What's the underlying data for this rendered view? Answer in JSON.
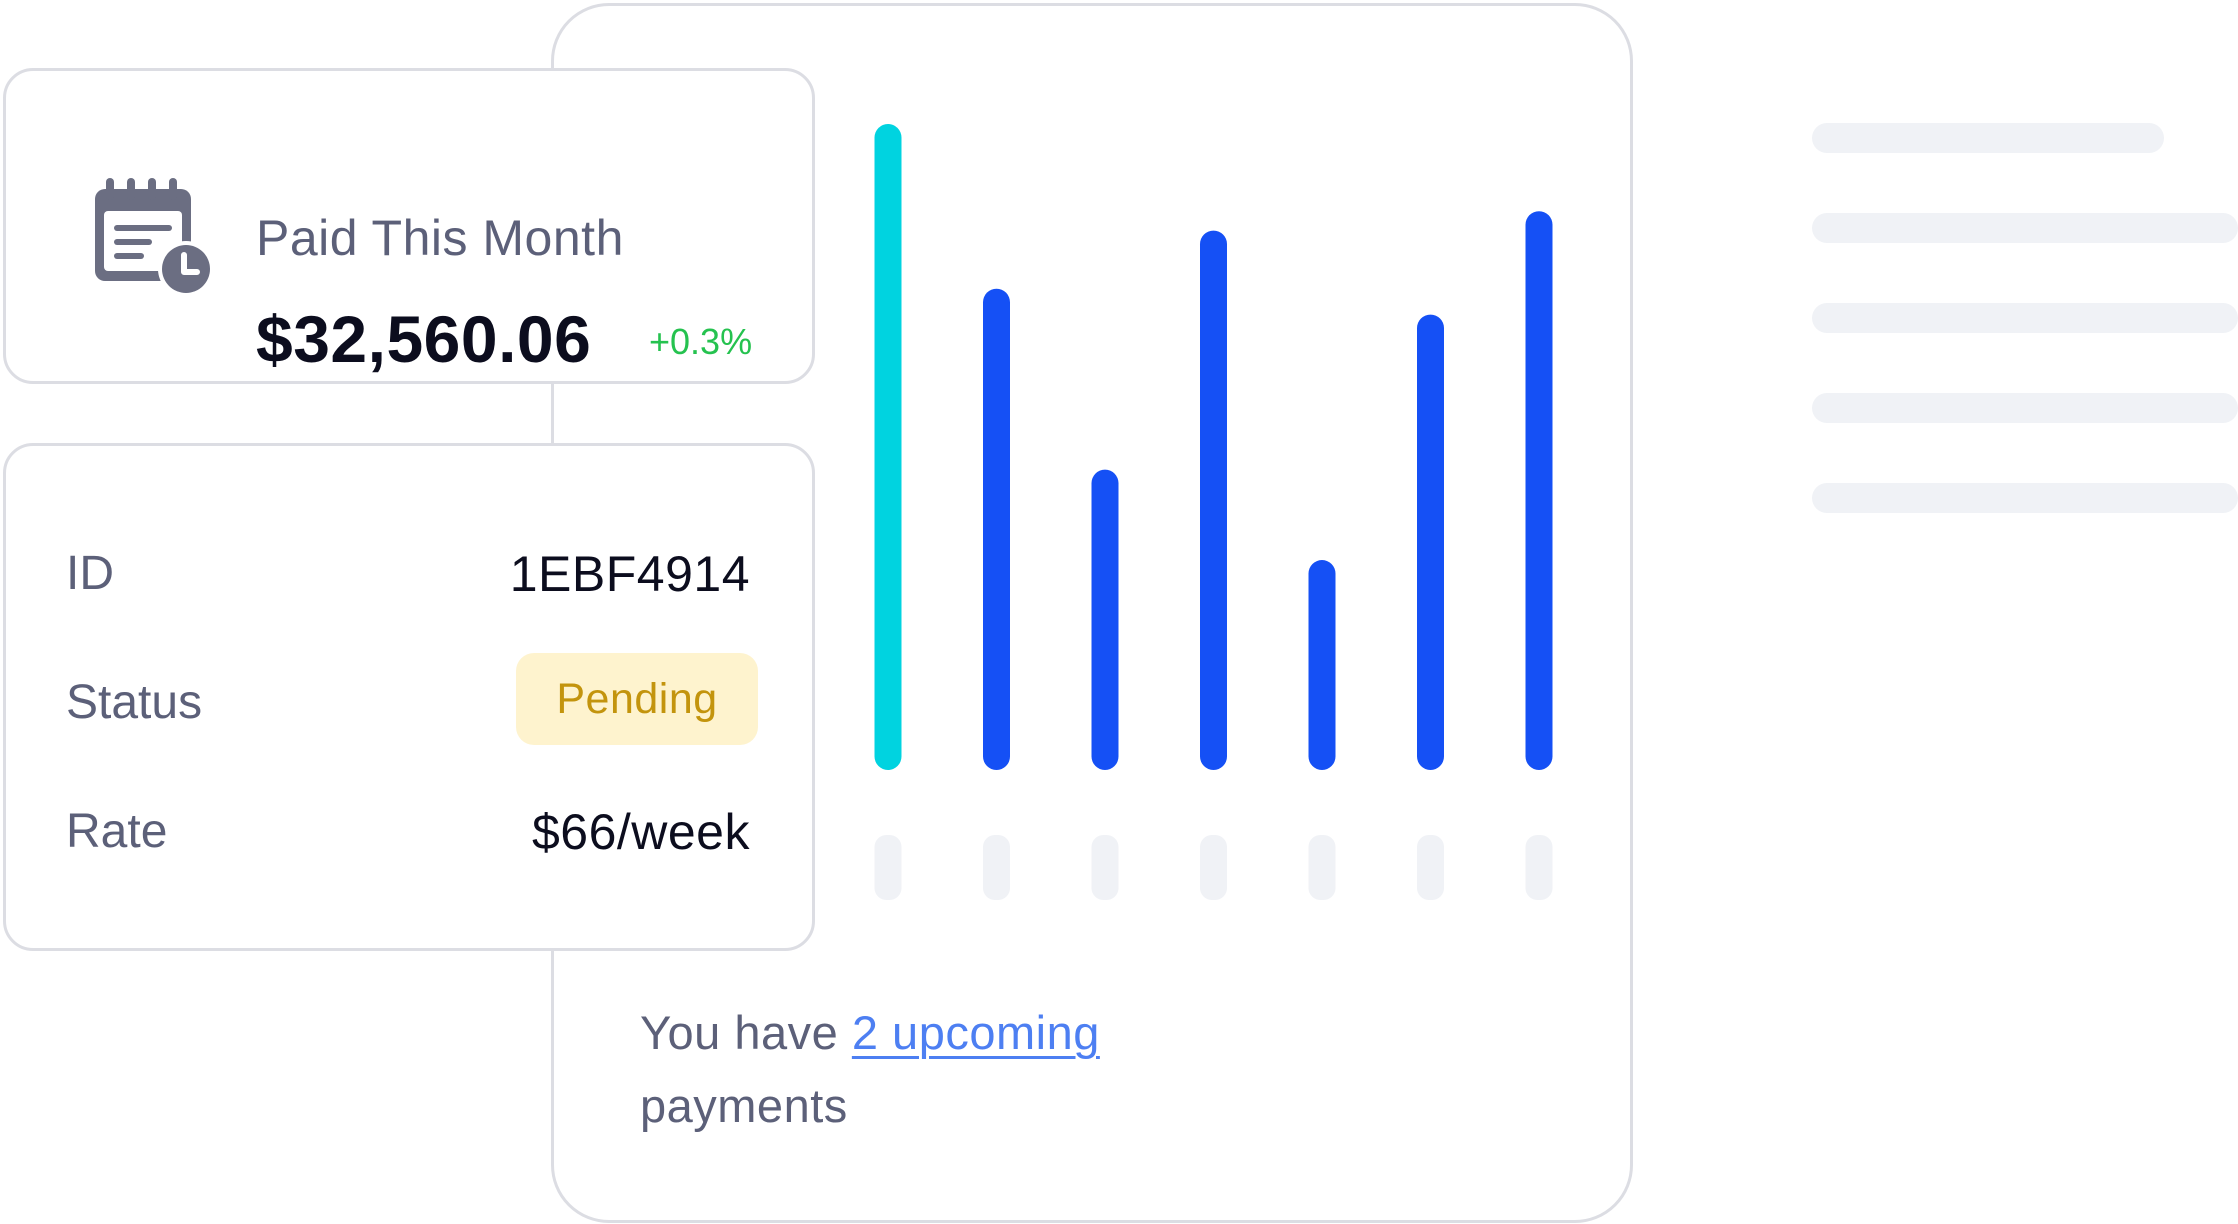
{
  "paid": {
    "title": "Paid This Month",
    "amount": "$32,560.06",
    "change": "+0.3%",
    "icon": "calendar-clock-icon"
  },
  "details": {
    "id_label": "ID",
    "id_value": "1EBF4914",
    "status_label": "Status",
    "status_value": "Pending",
    "rate_label": "Rate",
    "rate_value": "$66/week"
  },
  "footer": {
    "prefix": "You have ",
    "link": "2 upcoming",
    "suffix": "payments"
  },
  "colors": {
    "highlight_bar": "#00d3e0",
    "bar": "#1550f5",
    "placeholder": "#f0f2f6",
    "positive": "#25c24f",
    "pending_bg": "#fef3ce",
    "pending_text": "#c3940d",
    "link": "#4d7ff2"
  },
  "chart_data": {
    "type": "bar",
    "categories": [
      "",
      "",
      "",
      "",
      "",
      "",
      ""
    ],
    "values": [
      100,
      74.5,
      46.5,
      83.5,
      32.5,
      70.5,
      86.5
    ],
    "highlight_index": 0,
    "ylim": [
      0,
      100
    ],
    "grid": false,
    "legend": "none"
  }
}
